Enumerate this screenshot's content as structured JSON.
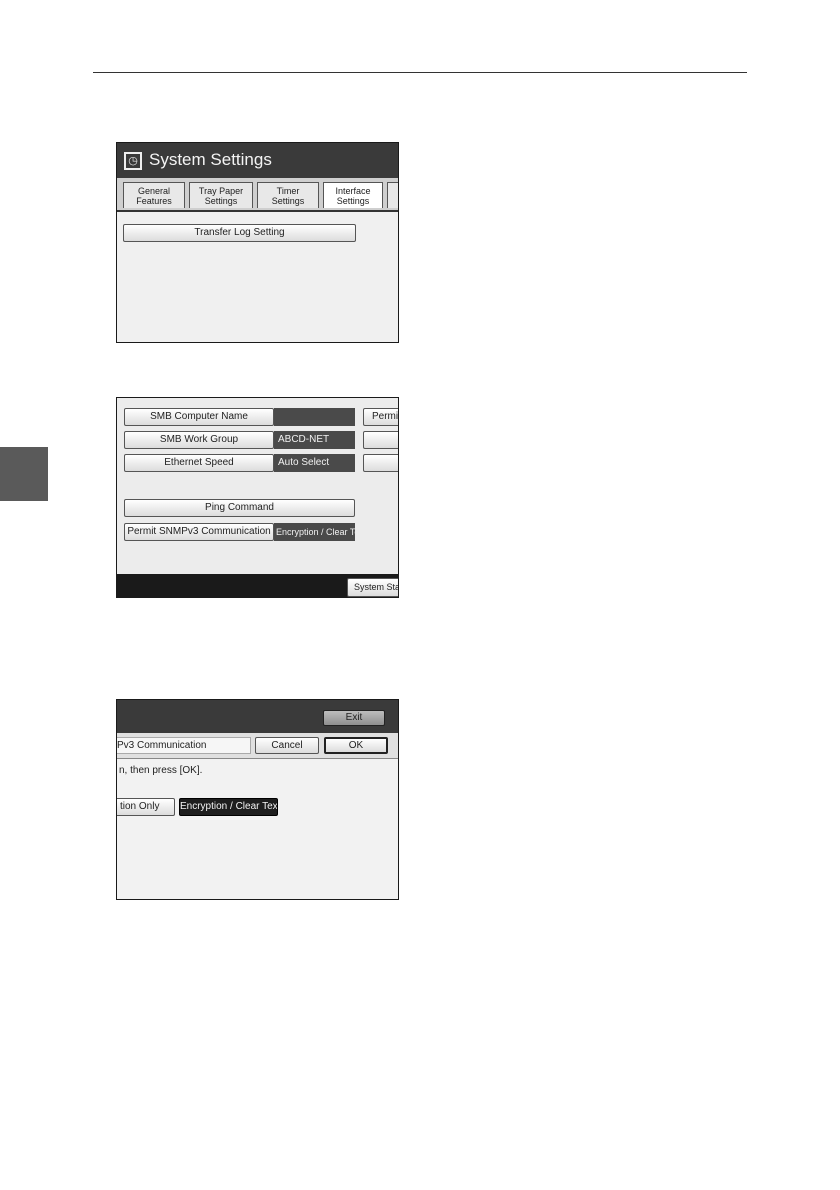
{
  "screen1": {
    "title": "System Settings",
    "tabs": [
      "General\nFeatures",
      "Tray Paper\nSettings",
      "Timer\nSettings",
      "Interface\nSettings"
    ],
    "transfer_log_label": "Transfer Log Setting"
  },
  "screen2": {
    "rows": [
      {
        "label": "SMB Computer Name",
        "value": ""
      },
      {
        "label": "SMB Work Group",
        "value": "ABCD-NET"
      },
      {
        "label": "Ethernet Speed",
        "value": "Auto Select"
      }
    ],
    "right_column": [
      "Permi",
      "",
      ""
    ],
    "ping_label": "Ping Command",
    "snmp_label": "Permit SNMPv3 Communication",
    "snmp_value": "Encryption / Clear Text",
    "system_status_label": "System Statu"
  },
  "screen3": {
    "exit_label": "Exit",
    "field_label": "Pv3 Communication",
    "cancel_label": "Cancel",
    "ok_label": "OK",
    "instruction": "n, then press [OK].",
    "option_encryption_only": "tion Only",
    "option_encryption_clear": "Encryption / Clear Text"
  }
}
